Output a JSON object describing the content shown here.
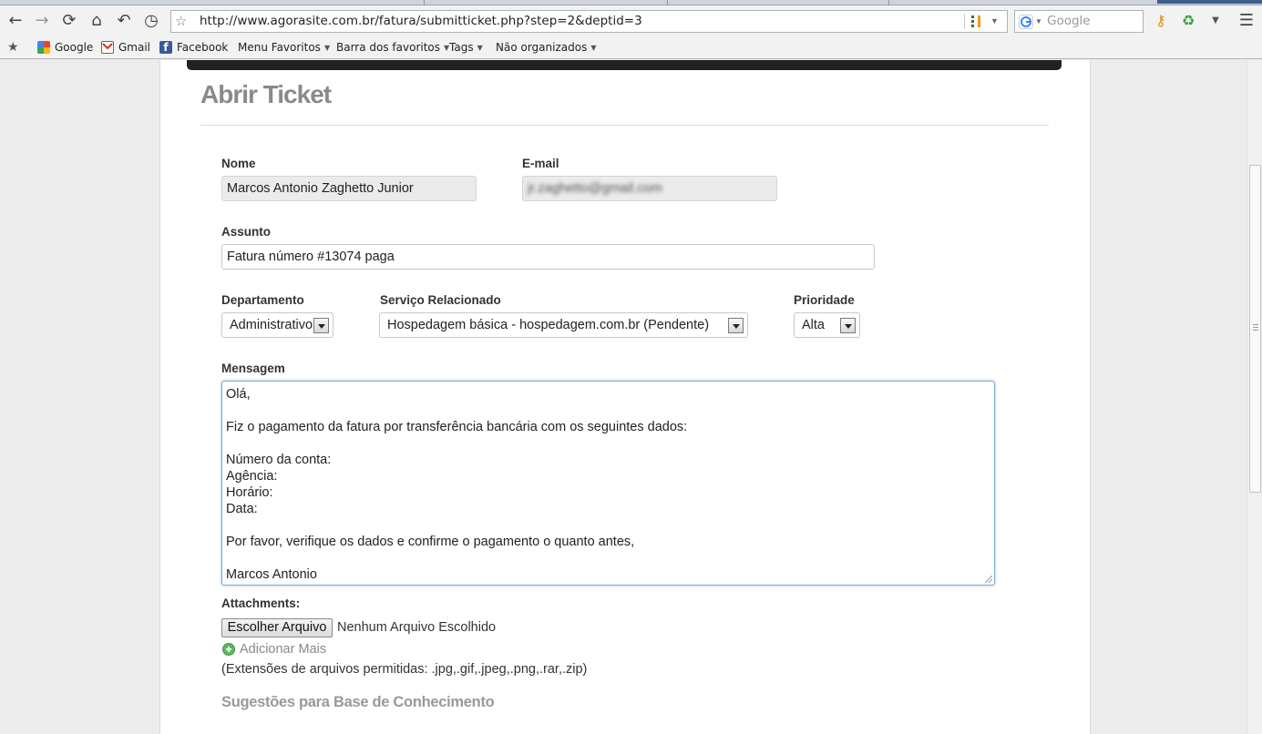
{
  "browser": {
    "url": "http://www.agorasite.com.br/fatura/submitticket.php?step=2&deptid=3",
    "search_placeholder": "Google",
    "bookmarks": [
      {
        "label": "Google",
        "color": "#ea4335"
      },
      {
        "label": "Gmail",
        "color": "#d93025"
      },
      {
        "label": "Facebook",
        "color": "#3b5998"
      },
      {
        "label": "Menu Favoritos"
      },
      {
        "label": "Barra dos favoritos"
      },
      {
        "label": "Tags"
      },
      {
        "label": "Não organizados"
      }
    ]
  },
  "page": {
    "title": "Abrir Ticket",
    "name_label": "Nome",
    "name_value": "Marcos Antonio Zaghetto Junior",
    "email_label": "E-mail",
    "email_value": "jr.zaghetto@gmail.com",
    "subject_label": "Assunto",
    "subject_value": "Fatura número #13074 paga",
    "department_label": "Departamento",
    "department_value": "Administrativo",
    "service_label": "Serviço Relacionado",
    "service_value": "Hospedagem básica - hospedagem.com.br (Pendente)",
    "priority_label": "Prioridade",
    "priority_value": "Alta",
    "message_label": "Mensagem",
    "message_lines": [
      "Olá,",
      "",
      "Fiz o pagamento da fatura por transferência bancária com os seguintes dados:",
      "",
      "Número da conta:",
      "Agência:",
      "Horário:",
      "Data:",
      "",
      "Por favor, verifique os dados e confirme o pagamento o quanto antes,",
      "",
      "Marcos Antonio"
    ],
    "attachments_label": "Attachments:",
    "file_button": "Escolher Arquivo",
    "file_status": "Nenhum Arquivo Escolhido",
    "add_more": "Adicionar Mais",
    "extensions_note": "(Extensões de arquivos permitidas: .jpg,.gif,.jpeg,.png,.rar,.zip)",
    "kb_title": "Sugestões para Base de Conhecimento"
  }
}
